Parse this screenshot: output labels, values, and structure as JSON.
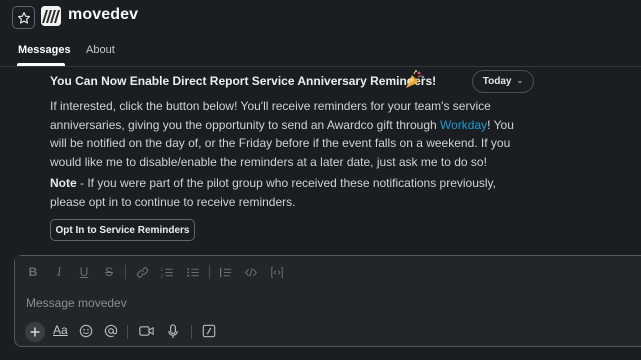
{
  "header": {
    "app_name": "movedev",
    "tabs": [
      {
        "label": "Messages",
        "active": true
      },
      {
        "label": "About",
        "active": false
      }
    ]
  },
  "message": {
    "title": "You Can Now Enable Direct Report Service Anniversary Reminders!",
    "title_emoji": "party-popper",
    "date_label": "Today",
    "paragraph1": {
      "line1": "If interested, click the button below! You'll receive reminders for your team's service",
      "line2_before": "anniversaries, giving you the opportunity to send an Awardco gift through ",
      "line2_link": "Workday",
      "line2_after": "! You",
      "line3": "will be notified on the day of, or the Friday before if the event falls on a weekend. If you",
      "line4": "would like me to disable/enable the reminders at a later date, just ask me to do so!"
    },
    "paragraph2": {
      "note_label": "Note",
      "line1_after": " - If you were part of the pilot group who received these notifications previously,",
      "line2": "please opt in to continue to receive reminders."
    },
    "button_label": "Opt In to Service Reminders"
  },
  "composer": {
    "placeholder": "Message movedev",
    "format_icons": [
      "bold-icon",
      "italic-icon",
      "underline-icon",
      "strikethrough-icon",
      "link-icon",
      "ordered-list-icon",
      "bulleted-list-icon",
      "blockquote-icon",
      "code-icon",
      "code-block-icon"
    ],
    "action_icons": [
      "plus-icon",
      "text-format-icon",
      "emoji-icon",
      "mention-icon",
      "video-icon",
      "microphone-icon",
      "slash-command-icon"
    ]
  },
  "colors": {
    "background": "#1a1d21",
    "link": "#1d9bd1",
    "composer_bg": "#222529"
  }
}
